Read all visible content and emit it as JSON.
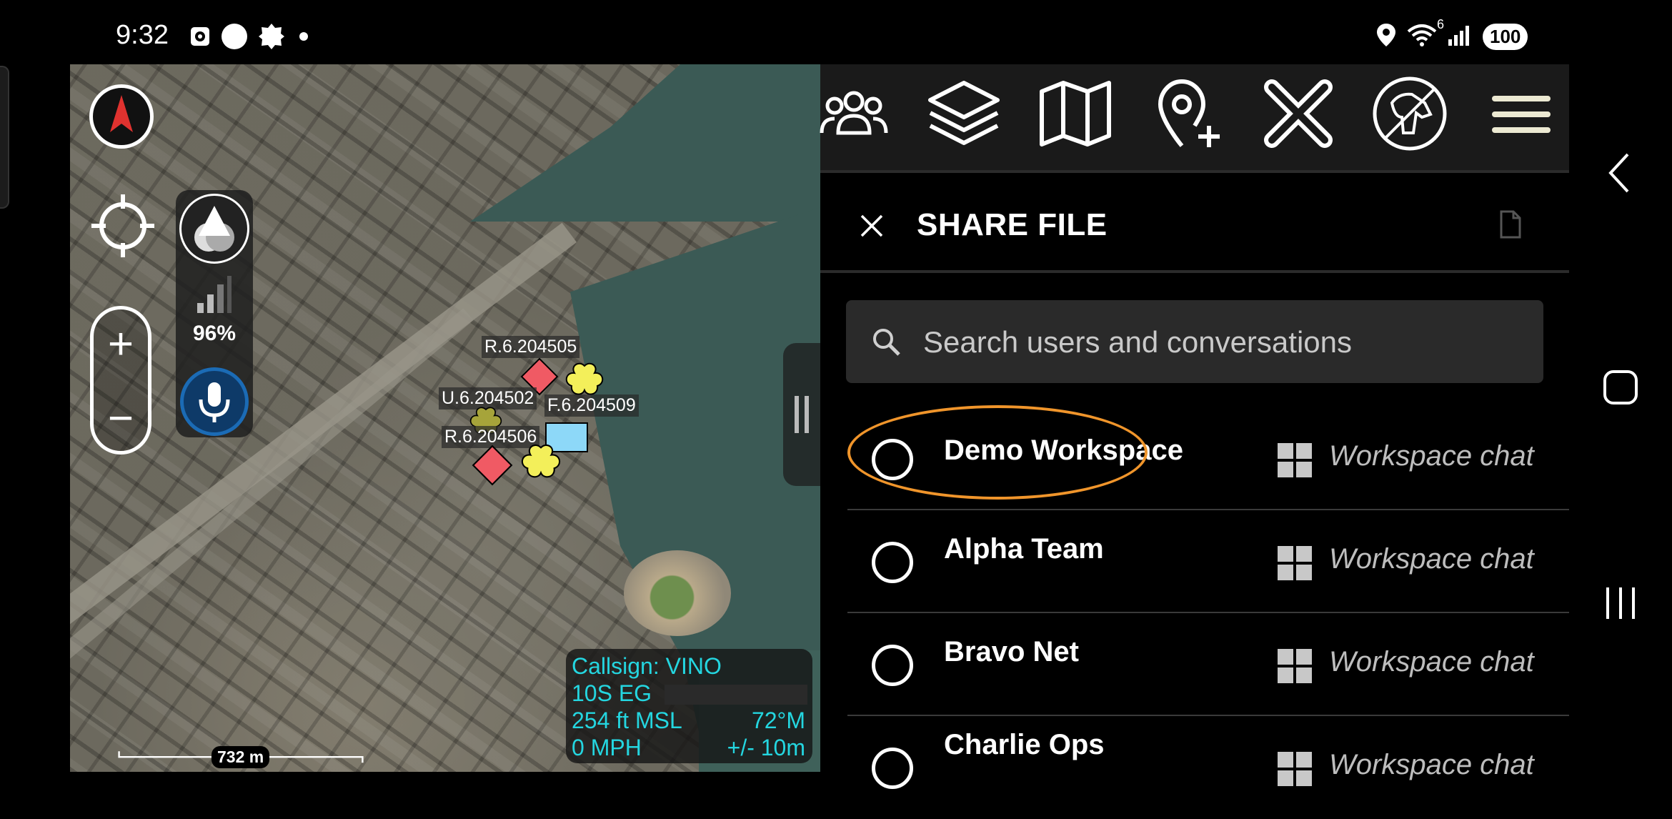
{
  "status_bar": {
    "time": "9:32",
    "left_icons": [
      "alarm-icon",
      "circle-icon",
      "badge-icon",
      "dot-icon"
    ],
    "right_icons": [
      "location-icon",
      "wifi-icon",
      "signal-icon"
    ],
    "wifi_label": "6",
    "battery": "100"
  },
  "map": {
    "network_percent": "96%",
    "markers": [
      {
        "label": "R.6.204505",
        "shape": "diamond",
        "color": "#f05a64"
      },
      {
        "label": "U.6.204502",
        "shape": "clover",
        "color": "#f3ef5a"
      },
      {
        "label": "F.6.204509",
        "shape": "clover",
        "color": "#f3ef5a"
      },
      {
        "label": "R.6.204506",
        "shape": "rectangle",
        "color": "#8dd8f8"
      }
    ],
    "info": {
      "callsign": "Callsign: VINO",
      "grid": "10S  EG",
      "altitude": "254 ft MSL",
      "heading": "72°M",
      "speed": "0 MPH",
      "accuracy": "+/- 10m"
    },
    "scale": "732 m"
  },
  "toolbar": {
    "icons": [
      "contacts-icon",
      "layers-icon",
      "map-icon",
      "add-point-icon",
      "close-tools-icon",
      "dog-icon",
      "menu-icon"
    ]
  },
  "share_file": {
    "title": "SHARE FILE",
    "search_placeholder": "Search users and conversations",
    "items": [
      {
        "name": "Demo Workspace",
        "type": "Workspace chat",
        "highlighted": true
      },
      {
        "name": "Alpha Team",
        "type": "Workspace chat",
        "highlighted": false
      },
      {
        "name": "Bravo Net",
        "type": "Workspace chat",
        "highlighted": false
      },
      {
        "name": "Charlie Ops",
        "type": "Workspace chat",
        "highlighted": false
      }
    ]
  },
  "colors": {
    "accent_highlight": "#f0952b",
    "info_text": "#24d6e0",
    "toolbar_bg": "#1a1a1a",
    "mic_blue": "#1b6bb5"
  }
}
